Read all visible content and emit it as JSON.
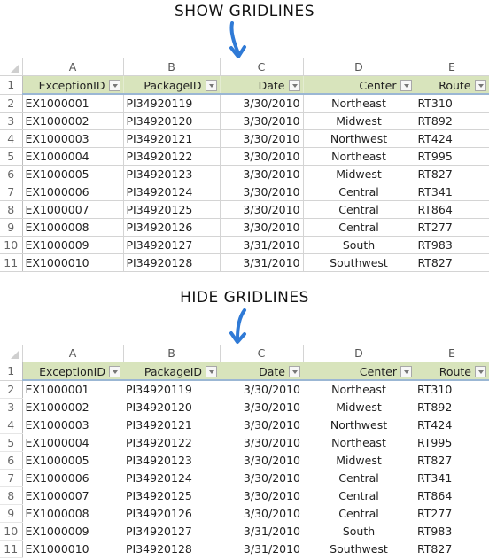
{
  "captions": {
    "show": "SHOW GRIDLINES",
    "hide": "HIDE GRIDLINES"
  },
  "colors": {
    "arrow": "#2f7ad6",
    "header_fill": "#d8e4bc",
    "header_border": "#9bb7d4",
    "gridline": "#d4d4d4"
  },
  "column_letters": [
    "A",
    "B",
    "C",
    "D",
    "E"
  ],
  "headers": [
    "ExceptionID",
    "PackageID",
    "Date",
    "Center",
    "Route"
  ],
  "row_numbers": [
    "1",
    "2",
    "3",
    "4",
    "5",
    "6",
    "7",
    "8",
    "9",
    "10",
    "11"
  ],
  "rows": [
    [
      "EX1000001",
      "PI34920119",
      "3/30/2010",
      "Northeast",
      "RT310"
    ],
    [
      "EX1000002",
      "PI34920120",
      "3/30/2010",
      "Midwest",
      "RT892"
    ],
    [
      "EX1000003",
      "PI34920121",
      "3/30/2010",
      "Northwest",
      "RT424"
    ],
    [
      "EX1000004",
      "PI34920122",
      "3/30/2010",
      "Northeast",
      "RT995"
    ],
    [
      "EX1000005",
      "PI34920123",
      "3/30/2010",
      "Midwest",
      "RT827"
    ],
    [
      "EX1000006",
      "PI34920124",
      "3/30/2010",
      "Central",
      "RT341"
    ],
    [
      "EX1000007",
      "PI34920125",
      "3/30/2010",
      "Central",
      "RT864"
    ],
    [
      "EX1000008",
      "PI34920126",
      "3/30/2010",
      "Central",
      "RT277"
    ],
    [
      "EX1000009",
      "PI34920127",
      "3/31/2010",
      "South",
      "RT983"
    ],
    [
      "EX1000010",
      "PI34920128",
      "3/31/2010",
      "Southwest",
      "RT827"
    ]
  ]
}
